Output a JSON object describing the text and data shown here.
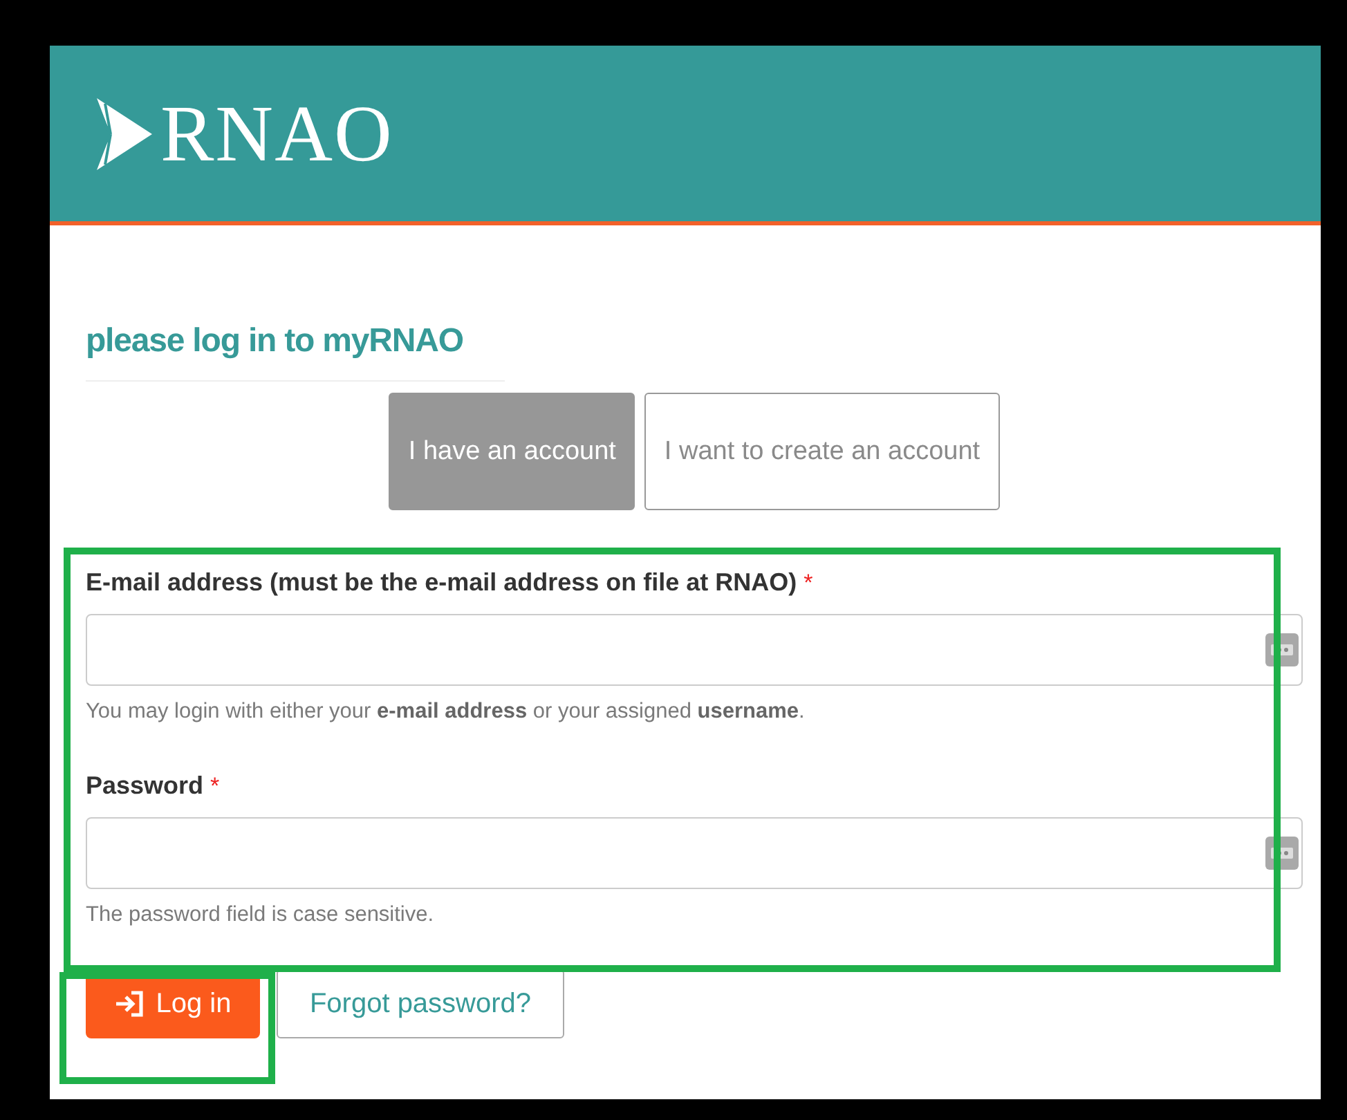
{
  "header": {
    "logo_text": "RNAO"
  },
  "heading": "please log in to myRNAO",
  "tabs": [
    {
      "label": "I have an account",
      "selected": true
    },
    {
      "label": "I want to create an account",
      "selected": false
    }
  ],
  "fields": [
    {
      "label": "E-mail address (must be the e-mail address on file at RNAO)",
      "required_mark": "*",
      "help": "You may login with either your **e-mail address** or your assigned **username**."
    },
    {
      "label": "Password",
      "required_mark": "*",
      "help": "The password field is case sensitive."
    }
  ],
  "login_button": "Log in",
  "forgot_link": "Forgot password?",
  "highlights": {
    "form": true,
    "login_button": true
  }
}
